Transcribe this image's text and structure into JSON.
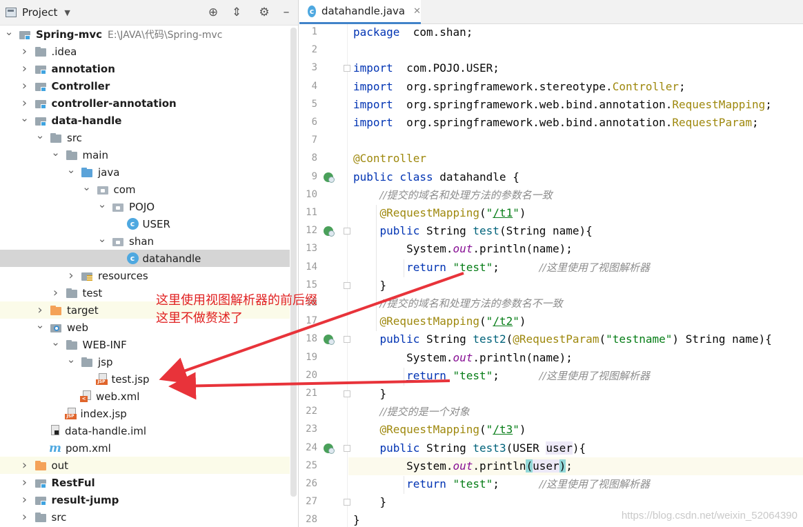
{
  "project_panel": {
    "title": "Project",
    "tree": [
      {
        "label": "Spring-mvc",
        "path": "E:\\JAVA\\代码\\Spring-mvc",
        "bold": true,
        "level": 0,
        "arrow": "open",
        "icon": "module-folder"
      },
      {
        "label": ".idea",
        "level": 1,
        "arrow": "closed",
        "icon": "gray-folder"
      },
      {
        "label": "annotation",
        "bold": true,
        "level": 1,
        "arrow": "closed",
        "icon": "module-folder"
      },
      {
        "label": "Controller",
        "bold": true,
        "level": 1,
        "arrow": "closed",
        "icon": "module-folder"
      },
      {
        "label": "controller-annotation",
        "bold": true,
        "level": 1,
        "arrow": "closed",
        "icon": "module-folder"
      },
      {
        "label": "data-handle",
        "bold": true,
        "level": 1,
        "arrow": "open",
        "icon": "module-folder"
      },
      {
        "label": "src",
        "level": 2,
        "arrow": "open",
        "icon": "gray-folder"
      },
      {
        "label": "main",
        "level": 3,
        "arrow": "open",
        "icon": "gray-folder"
      },
      {
        "label": "java",
        "level": 4,
        "arrow": "open",
        "icon": "blue-folder"
      },
      {
        "label": "com",
        "level": 5,
        "arrow": "open",
        "icon": "package-folder"
      },
      {
        "label": "POJO",
        "level": 6,
        "arrow": "open",
        "icon": "package-folder"
      },
      {
        "label": "USER",
        "level": 7,
        "arrow": "none",
        "icon": "class-icon"
      },
      {
        "label": "shan",
        "level": 6,
        "arrow": "open",
        "icon": "package-folder"
      },
      {
        "label": "datahandle",
        "level": 7,
        "arrow": "none",
        "icon": "class-icon",
        "selected": true
      },
      {
        "label": "resources",
        "level": 4,
        "arrow": "closed",
        "icon": "resources-folder"
      },
      {
        "label": "test",
        "level": 3,
        "arrow": "closed",
        "icon": "gray-folder"
      },
      {
        "label": "target",
        "level": 2,
        "arrow": "closed",
        "icon": "orange-folder",
        "highlight": true
      },
      {
        "label": "web",
        "level": 2,
        "arrow": "open",
        "icon": "web-folder"
      },
      {
        "label": "WEB-INF",
        "level": 3,
        "arrow": "open",
        "icon": "gray-folder"
      },
      {
        "label": "jsp",
        "level": 4,
        "arrow": "open",
        "icon": "gray-folder"
      },
      {
        "label": "test.jsp",
        "level": 5,
        "arrow": "none",
        "icon": "jsp-file"
      },
      {
        "label": "web.xml",
        "level": 4,
        "arrow": "none",
        "icon": "xml-file"
      },
      {
        "label": "index.jsp",
        "level": 3,
        "arrow": "none",
        "icon": "jsp-file"
      },
      {
        "label": "data-handle.iml",
        "level": 2,
        "arrow": "none",
        "icon": "iml-file"
      },
      {
        "label": "pom.xml",
        "level": 2,
        "arrow": "none",
        "icon": "maven-file"
      },
      {
        "label": "out",
        "level": 1,
        "arrow": "closed",
        "icon": "orange-folder",
        "highlight": true
      },
      {
        "label": "RestFul",
        "bold": true,
        "level": 1,
        "arrow": "closed",
        "icon": "module-folder"
      },
      {
        "label": "result-jump",
        "bold": true,
        "level": 1,
        "arrow": "closed",
        "icon": "module-folder"
      },
      {
        "label": "src",
        "level": 1,
        "arrow": "closed",
        "icon": "gray-folder"
      }
    ]
  },
  "editor": {
    "tab_label": "datahandle.java",
    "tab_close": "✕",
    "lines": [
      {
        "n": "1",
        "tokens": [
          [
            "kw",
            "package"
          ],
          [
            "",
            "  com.shan;"
          ]
        ]
      },
      {
        "n": "2",
        "tokens": []
      },
      {
        "n": "3",
        "tokens": [
          [
            "kw",
            "import"
          ],
          [
            "",
            "  com.POJO.USER;"
          ]
        ]
      },
      {
        "n": "4",
        "tokens": [
          [
            "kw",
            "import"
          ],
          [
            "",
            "  org.springframework.stereotype."
          ],
          [
            "ann",
            "Controller"
          ],
          [
            "",
            ";"
          ]
        ]
      },
      {
        "n": "5",
        "tokens": [
          [
            "kw",
            "import"
          ],
          [
            "",
            "  org.springframework.web.bind.annotation."
          ],
          [
            "ann",
            "RequestMapping"
          ],
          [
            "",
            ";"
          ]
        ]
      },
      {
        "n": "6",
        "tokens": [
          [
            "kw",
            "import"
          ],
          [
            "",
            "  org.springframework.web.bind.annotation."
          ],
          [
            "ann",
            "RequestParam"
          ],
          [
            "",
            ";"
          ]
        ]
      },
      {
        "n": "7",
        "tokens": []
      },
      {
        "n": "8",
        "tokens": [
          [
            "ann",
            "@Controller"
          ]
        ]
      },
      {
        "n": "9",
        "tokens": [
          [
            "kw",
            "public class "
          ],
          [
            "",
            "datahandle {"
          ]
        ]
      },
      {
        "n": "10",
        "tokens": [
          [
            "",
            "    "
          ],
          [
            "cmt",
            "//提交的域名和处理方法的参数名一致"
          ]
        ]
      },
      {
        "n": "11",
        "tokens": [
          [
            "",
            "    "
          ],
          [
            "ann",
            "@RequestMapping"
          ],
          [
            "",
            "("
          ],
          [
            "str",
            "\""
          ],
          [
            "str und",
            "/t1"
          ],
          [
            "str",
            "\""
          ],
          [
            "",
            ")"
          ]
        ]
      },
      {
        "n": "12",
        "tokens": [
          [
            "",
            "    "
          ],
          [
            "kw",
            "public "
          ],
          [
            "",
            "String "
          ],
          [
            "sig",
            "test"
          ],
          [
            "",
            "(String name){"
          ]
        ]
      },
      {
        "n": "13",
        "tokens": [
          [
            "",
            "        System."
          ],
          [
            "static",
            "out"
          ],
          [
            "",
            ".println(name);"
          ]
        ]
      },
      {
        "n": "14",
        "tokens": [
          [
            "",
            "        "
          ],
          [
            "kw",
            "return "
          ],
          [
            "str",
            "\"test\""
          ],
          [
            "",
            ";      "
          ],
          [
            "cmt",
            "//这里使用了视图解析器"
          ]
        ]
      },
      {
        "n": "15",
        "tokens": [
          [
            "",
            "    }"
          ]
        ]
      },
      {
        "n": "16",
        "tokens": [
          [
            "",
            "    "
          ],
          [
            "cmt",
            "//提交的域名和处理方法的参数名不一致"
          ]
        ]
      },
      {
        "n": "17",
        "tokens": [
          [
            "",
            "    "
          ],
          [
            "ann",
            "@RequestMapping"
          ],
          [
            "",
            "("
          ],
          [
            "str",
            "\""
          ],
          [
            "str und",
            "/t2"
          ],
          [
            "str",
            "\""
          ],
          [
            "",
            ")"
          ]
        ]
      },
      {
        "n": "18",
        "tokens": [
          [
            "",
            "    "
          ],
          [
            "kw",
            "public "
          ],
          [
            "",
            "String "
          ],
          [
            "sig",
            "test2"
          ],
          [
            "",
            "("
          ],
          [
            "ann",
            "@RequestParam"
          ],
          [
            "",
            "("
          ],
          [
            "str",
            "\"testname\""
          ],
          [
            "",
            ") String name){"
          ]
        ]
      },
      {
        "n": "19",
        "tokens": [
          [
            "",
            "        System."
          ],
          [
            "static",
            "out"
          ],
          [
            "",
            ".println(name);"
          ]
        ]
      },
      {
        "n": "20",
        "tokens": [
          [
            "",
            "        "
          ],
          [
            "kw und",
            "return"
          ],
          [
            "",
            ""
          ],
          [
            "str",
            " \"test\""
          ],
          [
            "",
            ";      "
          ],
          [
            "cmt",
            "//这里使用了视图解析器"
          ]
        ]
      },
      {
        "n": "21",
        "tokens": [
          [
            "",
            "    }"
          ]
        ]
      },
      {
        "n": "22",
        "tokens": [
          [
            "",
            "    "
          ],
          [
            "cmt",
            "//提交的是一个对象"
          ]
        ]
      },
      {
        "n": "23",
        "tokens": [
          [
            "",
            "    "
          ],
          [
            "ann",
            "@RequestMapping"
          ],
          [
            "",
            "("
          ],
          [
            "str",
            "\""
          ],
          [
            "str und",
            "/t3"
          ],
          [
            "str",
            "\""
          ],
          [
            "",
            ")"
          ]
        ]
      },
      {
        "n": "24",
        "tokens": [
          [
            "",
            "    "
          ],
          [
            "kw",
            "public "
          ],
          [
            "",
            "String "
          ],
          [
            "sig",
            "test3"
          ],
          [
            "",
            "(USER "
          ],
          [
            "hl-param",
            "user"
          ],
          [
            "",
            "){"
          ]
        ]
      },
      {
        "n": "25",
        "tokens": [
          [
            "",
            "        System."
          ],
          [
            "static",
            "out"
          ],
          [
            "",
            ".println"
          ],
          [
            "brk",
            "("
          ],
          [
            "hl-param",
            "user"
          ],
          [
            "brk",
            ")"
          ],
          [
            "",
            ";"
          ]
        ]
      },
      {
        "n": "26",
        "tokens": [
          [
            "",
            "        "
          ],
          [
            "kw",
            "return "
          ],
          [
            "str",
            "\"test\""
          ],
          [
            "",
            ";      "
          ],
          [
            "cmt",
            "//这里使用了视图解析器"
          ]
        ]
      },
      {
        "n": "27",
        "tokens": [
          [
            "",
            "    }"
          ]
        ]
      },
      {
        "n": "28",
        "tokens": [
          [
            "",
            "}"
          ]
        ]
      }
    ]
  },
  "annotation_note": {
    "line1": "这里使用视图解析器的前后缀",
    "line2": "这里不做赘述了",
    "color": "#e02020"
  },
  "watermark": "https://blog.csdn.net/weixin_52064390",
  "colors": {
    "accent": "#4083c9",
    "selection": "#d5d5d5",
    "arrow": "#e8333a"
  }
}
